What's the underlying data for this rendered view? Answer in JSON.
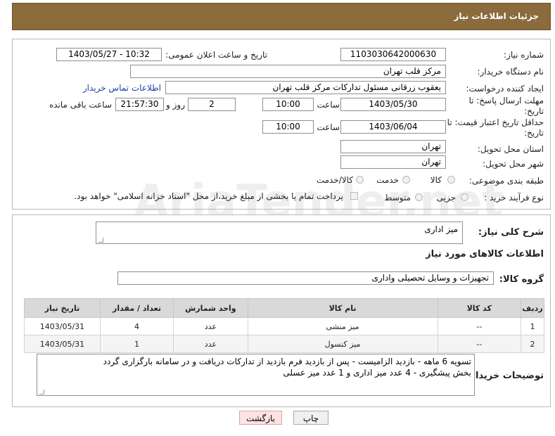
{
  "header": {
    "title": "جزئیات اطلاعات نیاز"
  },
  "watermark": "AriaTender.net",
  "form": {
    "need_number_label": "شماره نیاز:",
    "need_number": "1103030642000630",
    "announce_label": "تاریخ و ساعت اعلان عمومی:",
    "announce_value": "1403/05/27 - 10:32",
    "buyer_org_label": "نام دستگاه خریدار:",
    "buyer_org": "مرکز قلب تهران",
    "creator_label": "ایجاد کننده درخواست:",
    "creator": "یعقوب زرقانی مسئول تدارکات مرکز قلب تهران",
    "contact_link": "اطلاعات تماس خریدار",
    "reply_deadline_label_1": "مهلت ارسال پاسخ: تا",
    "reply_deadline_label_2": "تاریخ:",
    "reply_date": "1403/05/30",
    "time_label": "ساعت",
    "reply_time": "10:00",
    "days_value": "2",
    "days_label": "روز و",
    "remaining_time": "21:57:30",
    "remaining_label": "ساعت باقی مانده",
    "price_validity_label_1": "حداقل تاریخ اعتبار قیمت: تا",
    "price_validity_label_2": "تاریخ:",
    "price_date": "1403/06/04",
    "price_time": "10:00",
    "province_label": "استان محل تحویل:",
    "province": "تهران",
    "city_label": "شهر محل تحویل:",
    "city": "تهران",
    "category_label": "طبقه بندی موضوعی:",
    "category_options": [
      "کالا",
      "خدمت",
      "کالا/خدمت"
    ],
    "purchase_type_label": "نوع فرآیند خرید :",
    "purchase_options": [
      "جزیی",
      "متوسط"
    ],
    "payment_note": "پرداخت تمام یا بخشی از مبلغ خرید،از محل \"اسناد خزانه اسلامی\" خواهد بود."
  },
  "details": {
    "summary_label": "شرح کلی نیاز:",
    "summary": "میز اداری",
    "goods_info_title": "اطلاعات کالاهای مورد نیاز",
    "group_label": "گروه کالا:",
    "group": "تجهیزات و وسایل تحصیلی واداری"
  },
  "table": {
    "headers": [
      "ردیف",
      "کد کالا",
      "نام کالا",
      "واحد شمارش",
      "تعداد / مقدار",
      "تاریخ نیاز"
    ],
    "rows": [
      [
        "1",
        "--",
        "میز منشی",
        "عدد",
        "4",
        "1403/05/31"
      ],
      [
        "2",
        "--",
        "میز کنسول",
        "عدد",
        "1",
        "1403/05/31"
      ]
    ]
  },
  "buyer_notes": {
    "label": "توضیحات خریدار:",
    "line1": "تسویه 6 ماهه - بازدید الزامیست - پس از بازدید فرم بازدید از تدارکات دریافت و در سامانه بارگزاری گردد",
    "line2": "بخش پیشگیری -  4 عدد میز اداری  و 1 عدد میز عسلی"
  },
  "buttons": {
    "print": "چاپ",
    "back": "بازگشت"
  }
}
